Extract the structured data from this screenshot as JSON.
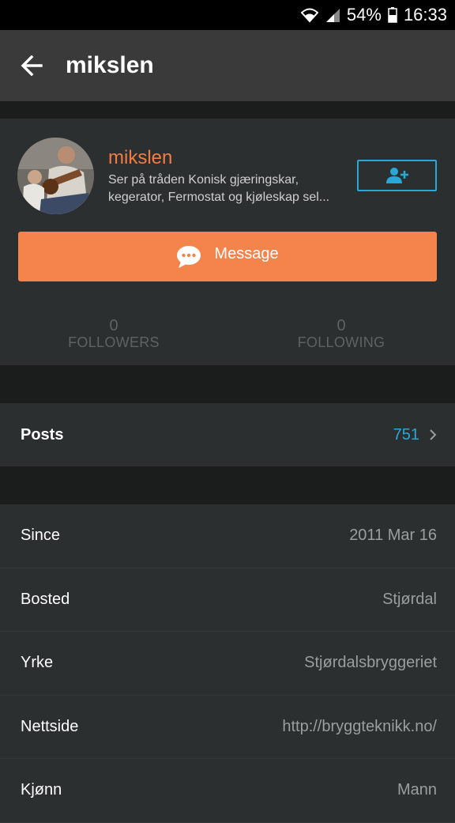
{
  "status_bar": {
    "battery_percent": "54%",
    "time": "16:33",
    "icons": [
      "wifi-icon",
      "signal-icon",
      "battery-icon"
    ]
  },
  "toolbar": {
    "back_icon": "arrow-left-icon",
    "title": "mikslen"
  },
  "profile": {
    "name": "mikslen",
    "status_line1": "Ser på tråden Konisk gjæringskar,",
    "status_line2": "kegerator, Fermostat og kjøleskap sel...",
    "follow_icon": "add-user-icon",
    "message_label": "Message",
    "message_icon": "chat-bubble-icon",
    "followers": {
      "count": "0",
      "label": "FOLLOWERS"
    },
    "following": {
      "count": "0",
      "label": "FOLLOWING"
    }
  },
  "posts": {
    "label": "Posts",
    "count": "751"
  },
  "info": [
    {
      "key": "Since",
      "value": "2011 Mar 16"
    },
    {
      "key": "Bosted",
      "value": "Stjørdal"
    },
    {
      "key": "Yrke",
      "value": "Stjørdalsbryggeriet"
    },
    {
      "key": "Nettside",
      "value": "http://bryggteknikk.no/"
    },
    {
      "key": "Kjønn",
      "value": "Mann"
    }
  ],
  "colors": {
    "accent_orange": "#f5844c",
    "accent_blue": "#29a7d6",
    "background": "#1b1c1c",
    "card": "#2c2f2f"
  }
}
